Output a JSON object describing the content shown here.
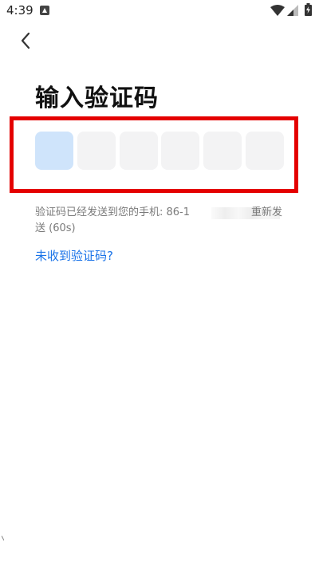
{
  "status_bar": {
    "time": "4:39"
  },
  "title": "输入验证码",
  "code_inputs": [
    "",
    "",
    "",
    "",
    "",
    ""
  ],
  "hint": {
    "sent_prefix": "验证码已经发送到您的手机: 86-1",
    "resend_line1": "重新发",
    "resend_line2": "送 (60s)"
  },
  "no_code_link": "未收到验证码?",
  "colors": {
    "accent_link": "#1a73e8",
    "active_box": "#cfe4fb",
    "inactive_box": "#f3f3f4",
    "highlight": "#e40000"
  },
  "icons": [
    "notification-icon",
    "wifi-icon",
    "signal-icon",
    "battery-icon",
    "back-arrow-icon"
  ]
}
